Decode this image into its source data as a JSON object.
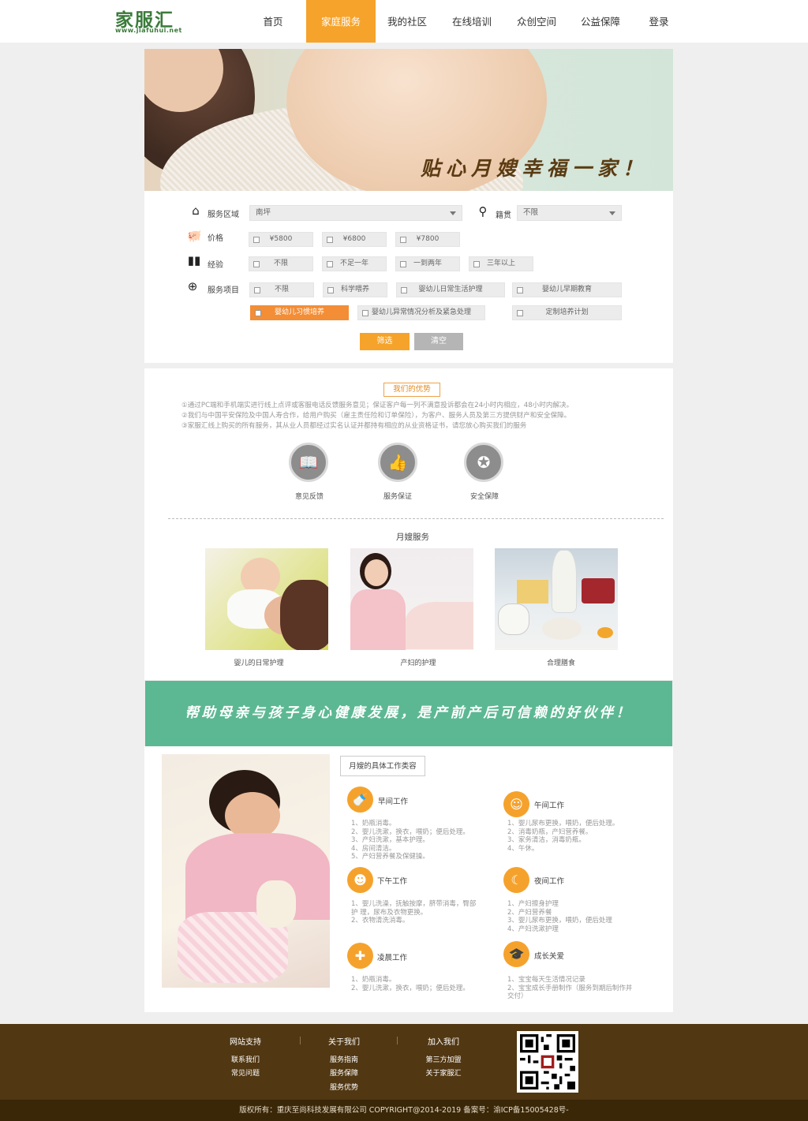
{
  "header": {
    "logo_text": "家服汇",
    "logo_url": "www.jiafuhui.net",
    "nav": [
      {
        "label": "首页",
        "active": false
      },
      {
        "label": "家庭服务",
        "active": true
      },
      {
        "label": "我的社区",
        "active": false
      },
      {
        "label": "在线培训",
        "active": false
      },
      {
        "label": "众创空间",
        "active": false
      },
      {
        "label": "公益保障",
        "active": false
      },
      {
        "label": "登录",
        "active": false
      }
    ]
  },
  "hero": {
    "slogan": "贴心月嫂幸福一家！"
  },
  "filter": {
    "region": {
      "label": "服务区域",
      "icon": "house-icon",
      "value": "南坪"
    },
    "origin": {
      "label": "籍贯",
      "icon": "location-pin-icon",
      "value": "不限"
    },
    "price": {
      "label": "价格",
      "icon": "piggy-bank-icon",
      "options": [
        "¥5800",
        "¥6800",
        "¥7800"
      ]
    },
    "experience": {
      "label": "经验",
      "icon": "bar-chart-icon",
      "options": [
        "不限",
        "不足一年",
        "一到两年",
        "三年以上"
      ]
    },
    "service": {
      "label": "服务项目",
      "icon": "globe-icon",
      "options_row1": [
        "不限",
        "科学喂养",
        "婴幼儿日常生活护理",
        "婴幼儿早期教育"
      ],
      "options_row2": [
        "婴幼儿习惯培养",
        "婴幼儿异常情况分析及紧急处理",
        "定制培养计划"
      ],
      "selected": "婴幼儿习惯培养"
    },
    "filter_button": "筛选",
    "clear_button": "清空"
  },
  "advantages": {
    "title": "我们的优势",
    "lines": [
      "①通过PC端和手机端实进行线上点评或客服电话反馈服务意见；保证客户每一列不满意投诉都会在24小时内相应，48小时内解决。",
      "②我们与中国平安保险及中国人寿合作，给用户购买（雇主责任险和订单保险），为客户、服务人员及第三方提供财产和安全保障。",
      "③家服汇线上购买的所有服务，其从业人员都经过实名认证并都持有相应的从业资格证书，请您放心购买我们的服务"
    ],
    "items": [
      {
        "label": "意见反馈",
        "icon": "book-icon"
      },
      {
        "label": "服务保证",
        "icon": "thumbs-up-icon"
      },
      {
        "label": "安全保障",
        "icon": "guarantee-seal-icon"
      }
    ]
  },
  "services": {
    "title": "月嫂服务",
    "items": [
      {
        "label": "婴儿的日常护理"
      },
      {
        "label": "产妇的护理"
      },
      {
        "label": "合理膳食"
      }
    ]
  },
  "banner": {
    "text": "帮助母亲与孩子身心健康发展，是产前产后可信赖的好伙伴！"
  },
  "work": {
    "tab": "月嫂的具体工作类容",
    "blocks": [
      {
        "title": "早间工作",
        "icon": "bottle-icon",
        "lines": [
          "1、奶瓶消毒。",
          "2、婴儿洗漱，换衣，喂奶；便后处理。",
          "3、产妇洗漱，基本护理。",
          "4、房间清洁。",
          "5、产妇营养餐及保健操。"
        ]
      },
      {
        "title": "午间工作",
        "icon": "baby-icon",
        "lines": [
          "1、婴儿尿布更换，喂奶，便后处理。",
          "2、消毒奶瓶，产妇营养餐。",
          "3、家务清洁，消毒奶瓶。",
          "4、午休。"
        ]
      },
      {
        "title": "下午工作",
        "icon": "nurse-icon",
        "lines": [
          "1、婴儿洗澡，抚触按摩，脐带消毒，臀部",
          "   护 理，尿布及衣物更换。",
          "2、衣物清洗消毒。"
        ]
      },
      {
        "title": "夜间工作",
        "icon": "moon-baby-icon",
        "lines": [
          "1、产妇擦身护理",
          "2、产妇营养餐",
          "3、婴儿尿布更换，喂奶，便后处理",
          "4、产妇洗漱护理"
        ]
      },
      {
        "title": "凌晨工作",
        "icon": "first-aid-icon",
        "lines": [
          "1、奶瓶消毒。",
          "2、婴儿洗漱，换衣，喂奶；便后处理。"
        ]
      },
      {
        "title": "成长关爱",
        "icon": "graduation-cap-icon",
        "lines": [
          "1、宝宝每天生活情况记录",
          "2、宝宝成长手册制作（服务到期后制作并",
          "   交付）"
        ]
      }
    ]
  },
  "footer": {
    "columns": [
      {
        "title": "网站支持",
        "links": [
          "联系我们",
          "常见问题"
        ]
      },
      {
        "title": "关于我们",
        "links": [
          "服务指南",
          "服务保障",
          "服务优势"
        ]
      },
      {
        "title": "加入我们",
        "links": [
          "第三方加盟",
          "关于家服汇"
        ]
      }
    ],
    "copyright": "版权所有：重庆至尚科技发展有限公司 COPYRIGHT@2014-2019 备案号：渝ICP备15005428号-"
  },
  "colors": {
    "accent": "#f6a32b",
    "orange_btn": "#f38d36",
    "green": "#5cb893",
    "footer": "#513712"
  }
}
